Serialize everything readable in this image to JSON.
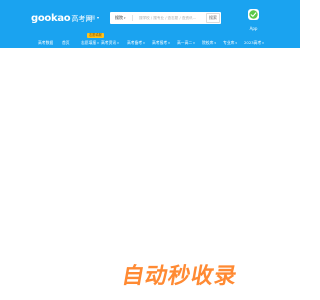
{
  "header": {
    "logo_latin": "gookao",
    "logo_cn": "高考网",
    "region": "全国",
    "search": {
      "type_label": "搜院",
      "placeholder": "搜学校 / 搜专业 / 查志愿 / 查资讯...",
      "button_label": "搜索"
    },
    "app": {
      "label": "App"
    }
  },
  "nav": {
    "items": [
      {
        "label": "高考数据",
        "has_dropdown": false
      },
      {
        "label": "首页",
        "has_dropdown": false
      },
      {
        "label": "志愿填报",
        "has_dropdown": true
      },
      {
        "label": "高考资讯",
        "has_dropdown": true
      },
      {
        "label": "高考备考",
        "has_dropdown": true
      },
      {
        "label": "高考报考",
        "has_dropdown": true
      },
      {
        "label": "高一高二",
        "has_dropdown": true
      },
      {
        "label": "院校库",
        "has_dropdown": true
      },
      {
        "label": "专业库",
        "has_dropdown": true
      },
      {
        "label": "2023高考",
        "has_dropdown": true
      }
    ],
    "badge": "志愿填报"
  },
  "body": {
    "loading_text": "自动秒收录"
  },
  "colors": {
    "header_bg": "#1aa3f0",
    "badge_bg": "#ffc21a",
    "loading_text": "#ff8a33",
    "app_icon_green": "#5cc84a"
  }
}
